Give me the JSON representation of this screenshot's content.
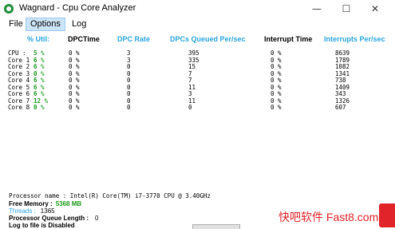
{
  "window": {
    "title": "Wagnard - Cpu Core Analyzer",
    "minimize": "—",
    "maximize": "☐",
    "close": "✕"
  },
  "menu": {
    "file": "File",
    "options": "Options",
    "log": "Log"
  },
  "table": {
    "headers": {
      "util": "% Util:",
      "dpc_time": "DPCTime",
      "dpc_rate": "DPC Rate",
      "dpcs_queued": "DPCs Queued Per/sec",
      "interrupt_time": "Interrupt Time",
      "interrupts": "Interrupts Per/sec"
    },
    "rows": [
      {
        "name": "CPU :",
        "util": "5 %",
        "dpc_time": "0 %",
        "dpc_rate": "3",
        "dpcs_queued": "395",
        "interrupt_time": "0 %",
        "interrupts": "8639"
      },
      {
        "name": "Core 1",
        "util": "6 %",
        "dpc_time": "0 %",
        "dpc_rate": "3",
        "dpcs_queued": "335",
        "interrupt_time": "0 %",
        "interrupts": "1789"
      },
      {
        "name": "Core 2",
        "util": "6 %",
        "dpc_time": "0 %",
        "dpc_rate": "0",
        "dpcs_queued": "15",
        "interrupt_time": "0 %",
        "interrupts": "1082"
      },
      {
        "name": "Core 3",
        "util": "0 %",
        "dpc_time": "0 %",
        "dpc_rate": "0",
        "dpcs_queued": "7",
        "interrupt_time": "0 %",
        "interrupts": "1341"
      },
      {
        "name": "Core 4",
        "util": "6 %",
        "dpc_time": "0 %",
        "dpc_rate": "0",
        "dpcs_queued": "7",
        "interrupt_time": "0 %",
        "interrupts": "738"
      },
      {
        "name": "Core 5",
        "util": "6 %",
        "dpc_time": "0 %",
        "dpc_rate": "0",
        "dpcs_queued": "11",
        "interrupt_time": "0 %",
        "interrupts": "1409"
      },
      {
        "name": "Core 6",
        "util": "6 %",
        "dpc_time": "0 %",
        "dpc_rate": "0",
        "dpcs_queued": "3",
        "interrupt_time": "0 %",
        "interrupts": "343"
      },
      {
        "name": "Core 7",
        "util": "12 %",
        "dpc_time": "0 %",
        "dpc_rate": "0",
        "dpcs_queued": "11",
        "interrupt_time": "0 %",
        "interrupts": "1326"
      },
      {
        "name": "Core 8",
        "util": "0 %",
        "dpc_time": "0 %",
        "dpc_rate": "0",
        "dpcs_queued": "0",
        "interrupt_time": "0 %",
        "interrupts": "607"
      }
    ]
  },
  "sysinfo": {
    "processor": "Processor name : Intel(R) Core(TM) i7-3770 CPU @ 3.40GHz",
    "free_memory_label": "Free Memory :",
    "free_memory_value": "5368 MB",
    "threads_label": "Threads :",
    "threads_value": "1365",
    "pql_label": "Processor Queue Length :",
    "pql_value": "0",
    "log_status": "Log to file is Disabled"
  },
  "watermark": {
    "text": "快吧软件 Fast8.com"
  },
  "colors": {
    "header_blue": "#2aa5e0",
    "value_green": "#1a9a1a",
    "menu_highlight": "#cce4f7",
    "watermark_red": "#e0242a"
  },
  "icons": {
    "app": "app-logo-icon",
    "minimize": "minimize-icon",
    "maximize": "maximize-icon",
    "close": "close-icon"
  }
}
